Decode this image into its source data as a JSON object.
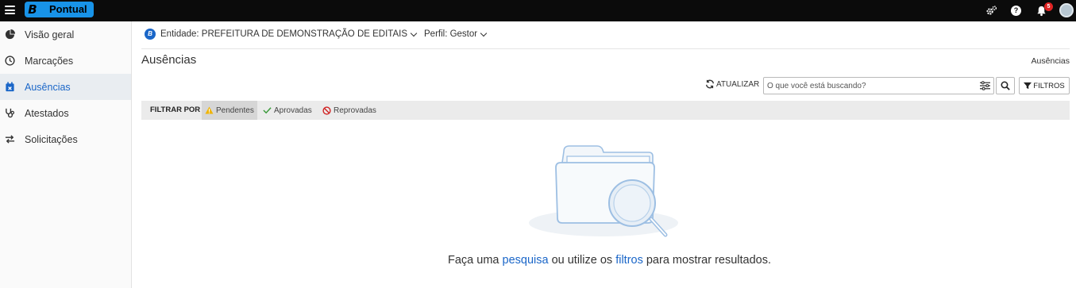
{
  "header": {
    "brand_letter": "B",
    "brand_name": "Pontual",
    "help_glyph": "?",
    "notification_count": "5",
    "brand_color": "#1893e8"
  },
  "sidebar": {
    "items": [
      {
        "label": "Visão geral",
        "icon": "pie-chart-icon"
      },
      {
        "label": "Marcações",
        "icon": "clock-icon"
      },
      {
        "label": "Ausências",
        "icon": "calendar-x-icon",
        "active": true
      },
      {
        "label": "Atestados",
        "icon": "stethoscope-icon"
      },
      {
        "label": "Solicitações",
        "icon": "exchange-icon"
      }
    ]
  },
  "context": {
    "entity_letter": "B",
    "entity": "Entidade: PREFEITURA DE DEMONSTRAÇÃO DE EDITAIS",
    "profile": "Perfil: Gestor"
  },
  "page": {
    "title": "Ausências",
    "breadcrumb": "Ausências"
  },
  "toolbar": {
    "refresh_label": "ATUALIZAR",
    "search_placeholder": "O que você está buscando?",
    "filters_label": "FILTROS"
  },
  "filter_bar": {
    "label": "FILTRAR POR",
    "chips": [
      {
        "label": "Pendentes",
        "icon": "warning-icon",
        "active": true
      },
      {
        "label": "Aprovadas",
        "icon": "check-icon"
      },
      {
        "label": "Reprovadas",
        "icon": "ban-icon"
      }
    ]
  },
  "empty_state": {
    "text_1": "Faça uma ",
    "link_1": "pesquisa",
    "text_2": " ou utilize os ",
    "link_2": "filtros",
    "text_3": " para mostrar resultados."
  },
  "colors": {
    "accent": "#1a66c8",
    "warning": "#f0b400",
    "success": "#3a9a3a",
    "danger": "#d02020"
  }
}
